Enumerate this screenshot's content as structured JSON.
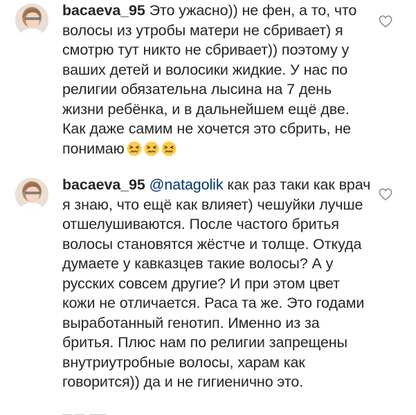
{
  "comments": [
    {
      "username": "bacaeva_95",
      "mention": "",
      "text": "Это ужасно)) не фен, а то, что волосы из утробы матери не сбривает) я смотрю тут никто не сбривает)) поэтому у ваших детей и волосики жидкие. У нас по религии обязательна лысина на 7 день жизни ребёнка, и в дальнейшем ещё две. Как даже самим не хочется это сбрить, не понимаю",
      "emojis": [
        "persevering-face",
        "persevering-face",
        "persevering-face"
      ]
    },
    {
      "username": "bacaeva_95",
      "mention": "@natagolik",
      "text": "как раз таки как врач я знаю, что ещё как влияет) чешуйки лучше отшелушиваются. После частого бритья волосы становятся жёстче и толще. Откуда думаете у кавказцев такие волосы? А у русских совсем другие? И при этом цвет кожи не отличается. Раса та же. Это годами выработанный генотип. Именно из за бритья. Плюс нам по религии запрещены внутриутробные волосы, харам как говорится)) да и не гигиенично это.",
      "emojis": []
    }
  ],
  "icons": {
    "like": "heart-outline-icon",
    "avatar": "user-avatar",
    "emoji": "persevering-face-emoji"
  },
  "colors": {
    "text": "#262626",
    "mention": "#003569",
    "icon": "#8e8e8e",
    "emoji_face": "#FFCB4C",
    "emoji_feature": "#65471B"
  }
}
